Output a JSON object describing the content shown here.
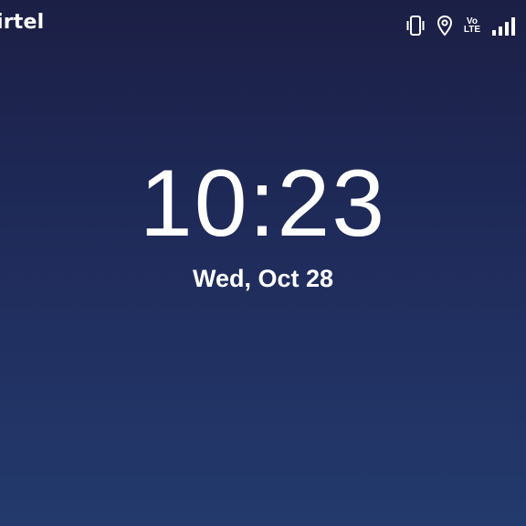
{
  "status_bar": {
    "carrier": "irtel",
    "icons": [
      "vibrate-icon",
      "location-icon",
      "volte-icon",
      "signal-icon"
    ],
    "volte_top": "Vo",
    "volte_bottom": "LTE"
  },
  "lock_screen": {
    "time": "10:23",
    "date": "Wed, Oct 28"
  },
  "colors": {
    "background_top": "#1b1f45",
    "background_bottom": "#233a6c",
    "text": "#ffffff"
  }
}
